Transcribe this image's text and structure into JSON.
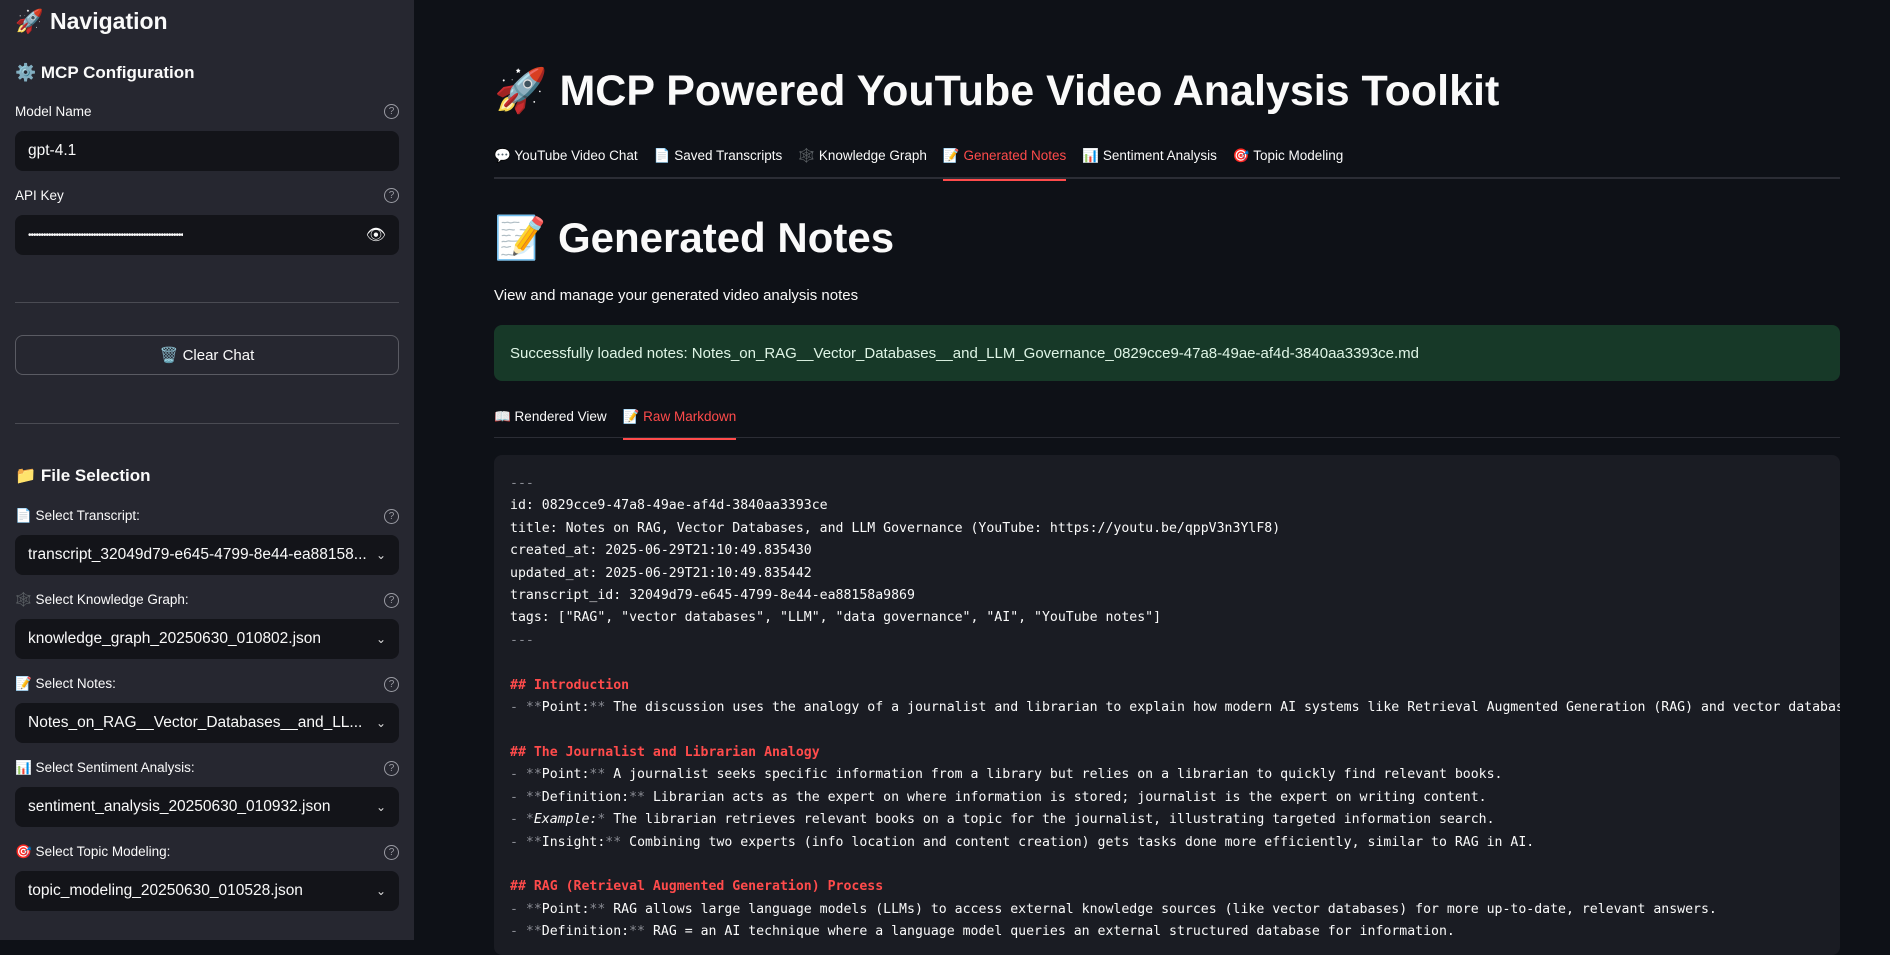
{
  "sidebar": {
    "title": "🚀 Navigation",
    "mcp_heading": "⚙️ MCP Configuration",
    "model_label": "Model Name",
    "model_value": "gpt-4.1",
    "api_label": "API Key",
    "api_value": "••••••••••••••••••••••••••••••••••••••••••••••••••••••••••••••",
    "clear_chat": "🗑️ Clear Chat",
    "file_heading": "📁 File Selection",
    "selects": [
      {
        "label": "📄 Select Transcript:",
        "value": "transcript_32049d79-e645-4799-8e44-ea88158..."
      },
      {
        "label": "🕸️ Select Knowledge Graph:",
        "value": "knowledge_graph_20250630_010802.json"
      },
      {
        "label": "📝 Select Notes:",
        "value": "Notes_on_RAG__Vector_Databases__and_LL..."
      },
      {
        "label": "📊 Select Sentiment Analysis:",
        "value": "sentiment_analysis_20250630_010932.json"
      },
      {
        "label": "🎯 Select Topic Modeling:",
        "value": "topic_modeling_20250630_010528.json"
      }
    ]
  },
  "main": {
    "title": "🚀 MCP Powered YouTube Video Analysis Toolkit",
    "tabs": [
      "💬 YouTube Video Chat",
      "📄 Saved Transcripts",
      "🕸️ Knowledge Graph",
      "📝 Generated Notes",
      "📊 Sentiment Analysis",
      "🎯 Topic Modeling"
    ],
    "heading": "📝 Generated Notes",
    "subtitle": "View and manage your generated video analysis notes",
    "alert": "Successfully loaded notes: Notes_on_RAG__Vector_Databases__and_LLM_Governance_0829cce9-47a8-49ae-af4d-3840aa3393ce.md",
    "subtabs": [
      "📖 Rendered View",
      "📝 Raw Markdown"
    ],
    "accent": "#ff4b4b"
  },
  "markdown": {
    "sep": "---",
    "front": [
      "id: 0829cce9-47a8-49ae-af4d-3840aa3393ce",
      "title: Notes on RAG, Vector Databases, and LLM Governance (YouTube: https://youtu.be/qppV3n3YlF8)",
      "created_at: 2025-06-29T21:10:49.835430",
      "updated_at: 2025-06-29T21:10:49.835442",
      "transcript_id: 32049d79-e645-4799-8e44-ea88158a9869",
      "tags: [\"RAG\", \"vector databases\", \"LLM\", \"data governance\", \"AI\", \"YouTube notes\"]"
    ],
    "h_intro": "## Introduction",
    "intro": [
      {
        "k": "Point:",
        "t": " The discussion uses the analogy of a journalist and librarian to explain how modern AI systems like Retrieval Augmented Generation (RAG) and vector databases work."
      }
    ],
    "h_analogy": "## The Journalist and Librarian Analogy",
    "analogy": [
      {
        "k": "Point:",
        "t": " A journalist seeks specific information from a library but relies on a librarian to quickly find relevant books."
      },
      {
        "k": "Definition:",
        "t": " Librarian acts as the expert on where information is stored; journalist is the expert on writing content."
      },
      {
        "k": "Example:",
        "t": " The librarian retrieves relevant books on a topic for the journalist, illustrating targeted information search."
      },
      {
        "k": "Insight:",
        "t": " Combining two experts (info location and content creation) gets tasks done more efficiently, similar to RAG in AI."
      }
    ],
    "h_rag": "## RAG (Retrieval Augmented Generation) Process",
    "rag": [
      {
        "k": "Point:",
        "t": " RAG allows large language models (LLMs) to access external knowledge sources (like vector databases) for more up-to-date, relevant answers."
      },
      {
        "k": "Definition:",
        "t": " RAG = an AI technique where a language model queries an external structured database for information."
      }
    ]
  }
}
